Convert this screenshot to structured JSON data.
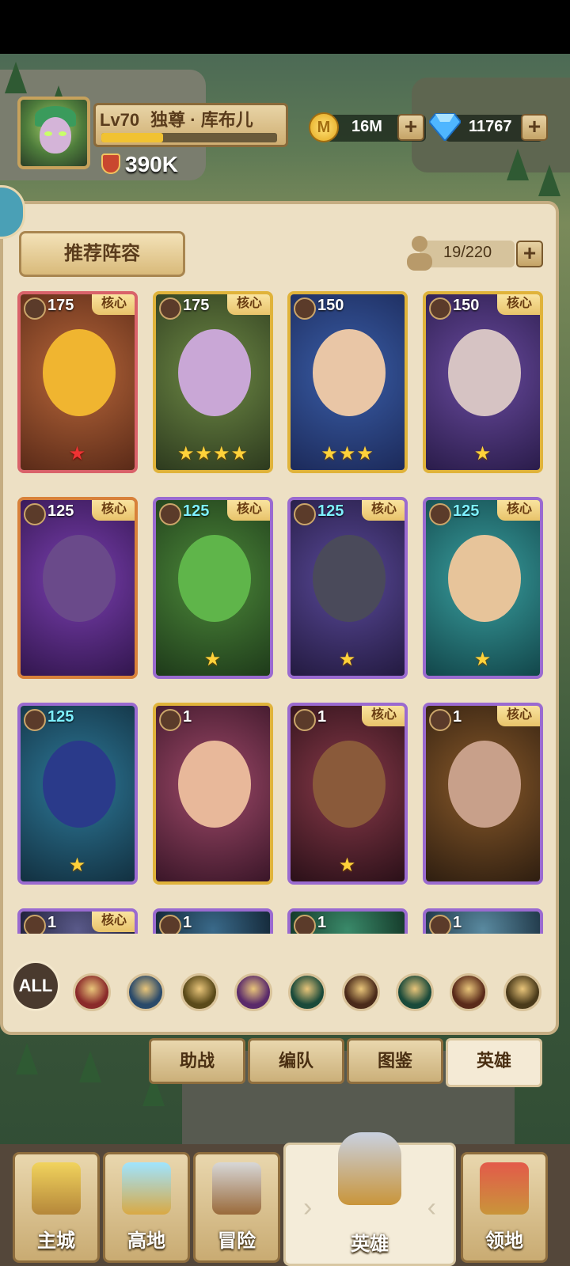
{
  "player": {
    "level": "Lv70",
    "name": "独尊 · 库布儿",
    "xp_fraction": 0.35,
    "power": "390K"
  },
  "resources": {
    "gold": "16M",
    "gems": "11767"
  },
  "panel": {
    "recommend_button": "推荐阵容",
    "hero_count": "19/220"
  },
  "core_label": "核心",
  "heroes": [
    {
      "level": "175",
      "core": true,
      "stars": "★",
      "class_icon": "shield-icon"
    },
    {
      "level": "175",
      "core": true,
      "stars": "★★★★",
      "class_icon": "bow-icon"
    },
    {
      "level": "150",
      "core": false,
      "stars": "★★★",
      "class_icon": "beast-icon"
    },
    {
      "level": "150",
      "core": true,
      "stars": "★",
      "class_icon": "axe-icon"
    },
    {
      "level": "125",
      "core": true,
      "stars": "",
      "class_icon": "holy-icon"
    },
    {
      "level": "125",
      "core": true,
      "stars": "★",
      "class_icon": "dagger-icon"
    },
    {
      "level": "125",
      "core": true,
      "stars": "★",
      "class_icon": "shield-icon"
    },
    {
      "level": "125",
      "core": true,
      "stars": "★",
      "class_icon": "mage-icon"
    },
    {
      "level": "125",
      "core": false,
      "stars": "★",
      "class_icon": "holy-icon"
    },
    {
      "level": "1",
      "core": false,
      "stars": "",
      "class_icon": "axe-icon"
    },
    {
      "level": "1",
      "core": true,
      "stars": "★",
      "class_icon": "beast-icon"
    },
    {
      "level": "1",
      "core": true,
      "stars": "",
      "class_icon": "dagger-icon"
    },
    {
      "level": "1",
      "core": true,
      "stars": "",
      "class_icon": "axe-icon"
    },
    {
      "level": "1",
      "core": false,
      "stars": "",
      "class_icon": "beast-icon"
    },
    {
      "level": "1",
      "core": false,
      "stars": "",
      "class_icon": "bow-icon"
    },
    {
      "level": "1",
      "core": false,
      "stars": "",
      "class_icon": "shield-icon"
    }
  ],
  "filters": {
    "all_label": "ALL",
    "icons": [
      "shield-icon",
      "mage-icon",
      "holy-icon",
      "skull-icon",
      "dagger-icon",
      "paw-icon",
      "bow-icon",
      "beast-icon",
      "axe-icon"
    ]
  },
  "subtabs": [
    "助战",
    "编队",
    "图鉴",
    "英雄"
  ],
  "nav": [
    "主城",
    "高地",
    "冒险",
    "英雄",
    "领地"
  ]
}
